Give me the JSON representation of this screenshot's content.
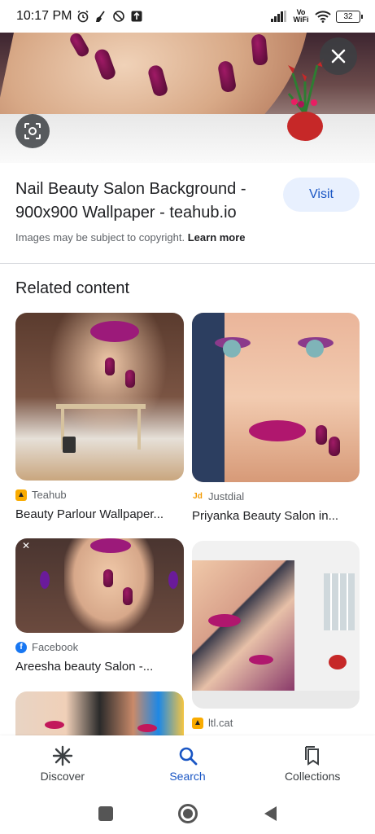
{
  "status_bar": {
    "time": "10:17 PM",
    "network": "Vo WiFi",
    "battery": "32"
  },
  "hero": {
    "close_icon": "close-icon",
    "lens_icon": "lens-icon"
  },
  "result": {
    "title": "Nail Beauty Salon Background - 900x900 Wallpaper - teahub.io",
    "visit_label": "Visit",
    "copyright_text": "Images may be subject to copyright.",
    "learn_more": "Learn more"
  },
  "related": {
    "heading": "Related content",
    "cards": [
      {
        "source": "Teahub",
        "caption": "Beauty Parlour Wallpaper..."
      },
      {
        "source": "Justdial",
        "caption": "Priyanka Beauty Salon in..."
      },
      {
        "source": "Facebook",
        "caption": "Areesha beauty Salon -..."
      },
      {
        "source": "ltl.cat",
        "caption": ""
      }
    ]
  },
  "bottom_nav": [
    {
      "label": "Discover",
      "icon": "asterisk-icon"
    },
    {
      "label": "Search",
      "icon": "search-icon"
    },
    {
      "label": "Collections",
      "icon": "collections-icon"
    }
  ],
  "colors": {
    "accent": "#1a56c4",
    "visit_bg": "#e8f0fe",
    "nail": "#8a1457"
  }
}
